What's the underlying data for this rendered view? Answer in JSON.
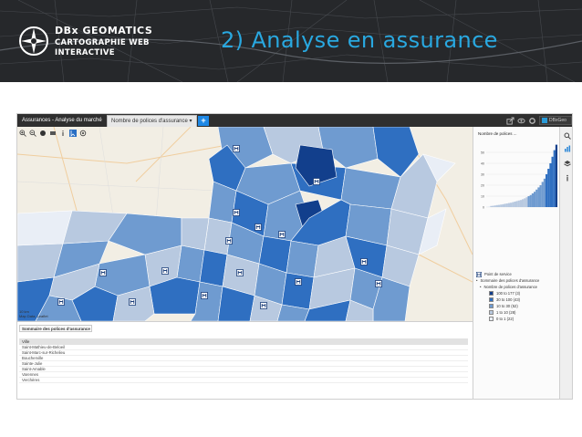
{
  "header": {
    "brand_line1": "DBx GEOMATICS",
    "brand_line2": "CARTOGRAPHIE WEB",
    "brand_line3": "INTERACTIVE",
    "title": "2) Analyse en assurance"
  },
  "topbar": {
    "tab_label": "Assurances - Analyse du marché",
    "selected_tab": "Nombre de polices d'assurance",
    "add_label": "+",
    "brand_text": "DBxGeo"
  },
  "map": {
    "scale_text_1": "10 km",
    "scale_text_2": "Map Data, Leaflet"
  },
  "table": {
    "summary_title": "Sommaire des polices d'assurance",
    "column_header": "Ville",
    "rows": [
      "Saint-Mathieu-de-Beloeil",
      "Saint-Marc-sur-Richelieu",
      "Boucherville",
      "Sainte-Julie",
      "Saint-Amable",
      "Varennes",
      "Verchères"
    ]
  },
  "chart_data": {
    "type": "bar",
    "title": "Nombre de polices ...",
    "xlabel": "",
    "ylabel": "",
    "ylim": [
      0,
      60
    ],
    "ticks": [
      0,
      10,
      20,
      30,
      40,
      50
    ],
    "values": [
      0.5,
      0.8,
      1,
      1.2,
      1.5,
      1.8,
      2,
      2.3,
      2.6,
      3,
      3.3,
      3.7,
      4,
      4.5,
      5,
      5.5,
      6,
      6.5,
      7.2,
      8,
      9,
      10,
      11,
      12.5,
      14,
      16,
      18,
      20,
      23,
      26,
      30,
      35,
      40,
      46,
      52,
      57
    ],
    "colors": {
      "c1": "#e9eef6",
      "c2": "#b8c9e0",
      "c3": "#6f9bd0",
      "c4": "#2f6fc1",
      "c5": "#123f8c"
    }
  },
  "legend": {
    "point_label": "Point de service",
    "summary_label": "Sommaire des polices d'assurance",
    "sub_label": "Nombre de polices d'assurance",
    "classes": [
      {
        "label": "100 to 177 (3)",
        "color": "#123f8c"
      },
      {
        "label": "30 to 100 (43)",
        "color": "#2f6fc1"
      },
      {
        "label": "10 to 30 (52)",
        "color": "#6f9bd0"
      },
      {
        "label": "1 to 10 (28)",
        "color": "#b8c9e0"
      },
      {
        "label": "0 to 1 (22)",
        "color": "#e9eef6"
      }
    ]
  }
}
